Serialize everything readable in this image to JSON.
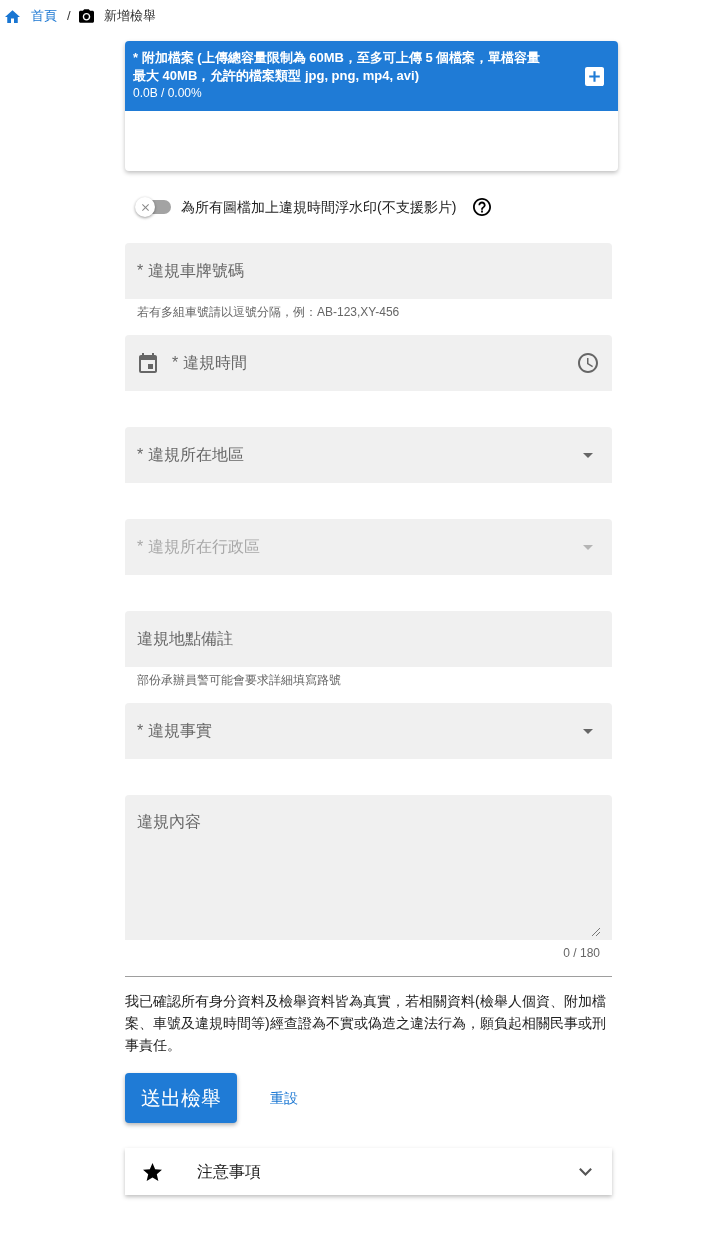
{
  "breadcrumb": {
    "separator": "/",
    "items": [
      {
        "kind": "link",
        "label": "首頁"
      },
      {
        "kind": "current",
        "label": "新增檢舉"
      }
    ]
  },
  "upload": {
    "title": "* 附加檔案 (上傳總容量限制為 60MB，至多可上傳 5 個檔案，單檔容量最大 40MB，允許的檔案類型 jpg, png, mp4, avi)",
    "usage": "0.0B / 0.00%"
  },
  "watermark_toggle": {
    "label": "為所有圖檔加上違規時間浮水印(不支援影片)",
    "on": false
  },
  "fields": [
    {
      "kind": "text",
      "label": "* 違規車牌號碼",
      "helper": "若有多組車號請以逗號分隔，例：AB-123,XY-456",
      "disabled": false
    },
    {
      "kind": "datetime",
      "label": "* 違規時間",
      "disabled": false
    },
    {
      "kind": "select",
      "label": "* 違規所在地區",
      "disabled": false
    },
    {
      "kind": "select",
      "label": "* 違規所在行政區",
      "disabled": true
    },
    {
      "kind": "text",
      "label": "違規地點備註",
      "helper": "部份承辦員警可能會要求詳細填寫路號",
      "disabled": false
    },
    {
      "kind": "select",
      "label": "* 違規事實",
      "disabled": false
    }
  ],
  "content_field": {
    "label": "違規內容",
    "counter": "0 / 180"
  },
  "declaration": "我已確認所有身分資料及檢舉資料皆為真實，若相關資料(檢舉人個資、附加檔案、車號及違規時間等)經查證為不實或偽造之違法行為，願負起相關民事或刑事責任。",
  "actions": {
    "submit": "送出檢舉",
    "reset": "重設"
  },
  "notice": {
    "label": "注意事項",
    "expanded": false
  }
}
